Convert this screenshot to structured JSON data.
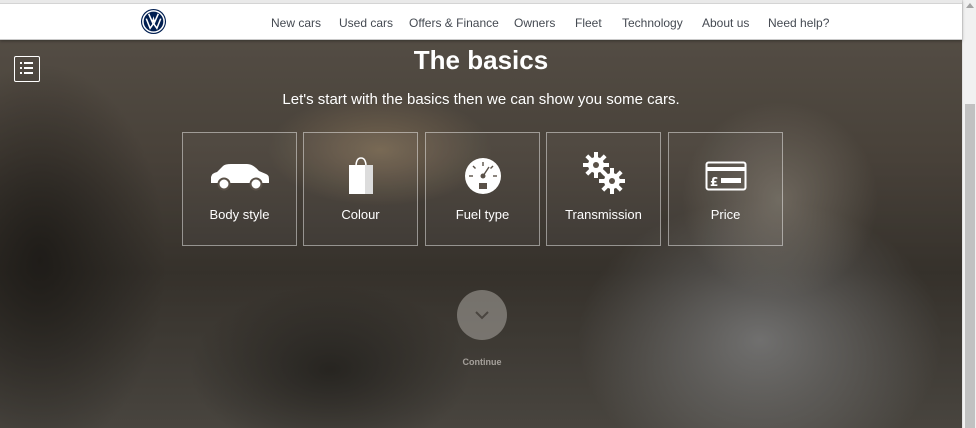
{
  "nav": {
    "logo": "vw-logo",
    "items": [
      {
        "label": "New cars"
      },
      {
        "label": "Used cars"
      },
      {
        "label": "Offers & Finance"
      },
      {
        "label": "Owners"
      },
      {
        "label": "Fleet"
      },
      {
        "label": "Technology"
      },
      {
        "label": "About us"
      },
      {
        "label": "Need help?"
      }
    ]
  },
  "hero": {
    "title": "The basics",
    "subtitle": "Let's start with the basics then we can show you some cars."
  },
  "tiles": [
    {
      "label": "Body style",
      "icon": "car-icon"
    },
    {
      "label": "Colour",
      "icon": "shopping-bag-icon"
    },
    {
      "label": "Fuel type",
      "icon": "fuel-gauge-icon"
    },
    {
      "label": "Transmission",
      "icon": "gears-icon"
    },
    {
      "label": "Price",
      "icon": "pound-card-icon"
    }
  ],
  "continue": {
    "label": "Continue",
    "icon": "chevron-down-icon"
  },
  "colors": {
    "brand": "#001e50",
    "nav_text": "#454a52",
    "hero_text": "#ffffff"
  }
}
